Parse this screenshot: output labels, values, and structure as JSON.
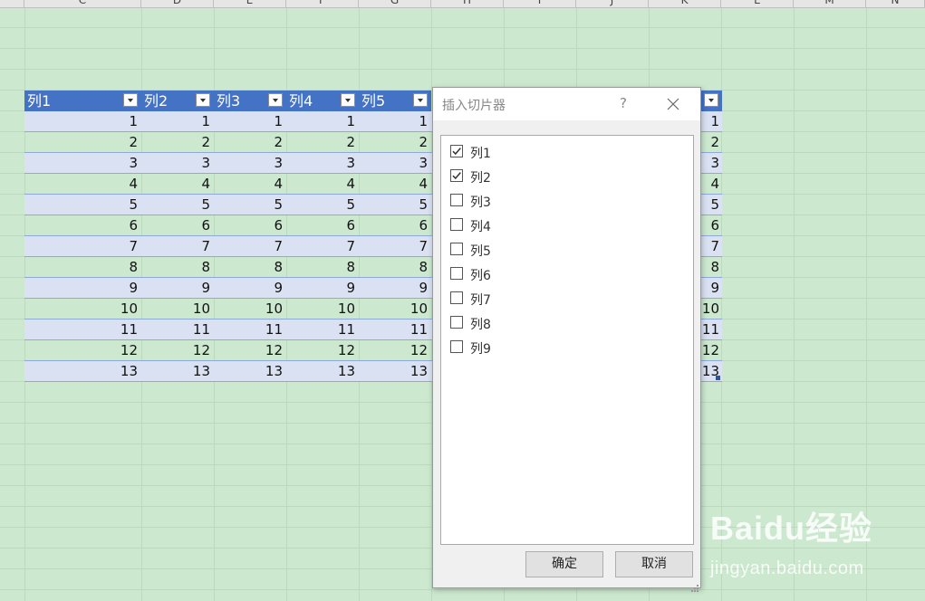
{
  "spreadsheet": {
    "column_letters": [
      "C",
      "D",
      "E",
      "F",
      "G",
      "H",
      "I",
      "J",
      "K",
      "L",
      "M",
      "N"
    ],
    "table": {
      "headers": [
        "列1",
        "列2",
        "列3",
        "列4",
        "列5"
      ],
      "rows": [
        [
          "1",
          "1",
          "1",
          "1",
          "1",
          "1"
        ],
        [
          "2",
          "2",
          "2",
          "2",
          "2",
          "2"
        ],
        [
          "3",
          "3",
          "3",
          "3",
          "3",
          "3"
        ],
        [
          "4",
          "4",
          "4",
          "4",
          "4",
          "4"
        ],
        [
          "5",
          "5",
          "5",
          "5",
          "5",
          "5"
        ],
        [
          "6",
          "6",
          "6",
          "6",
          "6",
          "6"
        ],
        [
          "7",
          "7",
          "7",
          "7",
          "7",
          "7"
        ],
        [
          "8",
          "8",
          "8",
          "8",
          "8",
          "8"
        ],
        [
          "9",
          "9",
          "9",
          "9",
          "9",
          "9"
        ],
        [
          "10",
          "10",
          "10",
          "10",
          "10",
          "10"
        ],
        [
          "11",
          "11",
          "11",
          "11",
          "11",
          "11"
        ],
        [
          "12",
          "12",
          "12",
          "12",
          "12",
          "12"
        ],
        [
          "13",
          "13",
          "13",
          "13",
          "13",
          "13"
        ]
      ]
    }
  },
  "dialog": {
    "title": "插入切片器",
    "help": "?",
    "options": [
      {
        "label": "列1",
        "checked": true
      },
      {
        "label": "列2",
        "checked": true
      },
      {
        "label": "列3",
        "checked": false
      },
      {
        "label": "列4",
        "checked": false
      },
      {
        "label": "列5",
        "checked": false
      },
      {
        "label": "列6",
        "checked": false
      },
      {
        "label": "列7",
        "checked": false
      },
      {
        "label": "列8",
        "checked": false
      },
      {
        "label": "列9",
        "checked": false
      }
    ],
    "ok_label": "确定",
    "cancel_label": "取消"
  },
  "watermark": {
    "brand": "Baidu经验",
    "url": "jingyan.baidu.com"
  },
  "colors": {
    "sheet_background": "#cce8cf",
    "table_header": "#4472c4",
    "table_band": "#d9e1f2",
    "dialog_background": "#f0f0f0"
  }
}
